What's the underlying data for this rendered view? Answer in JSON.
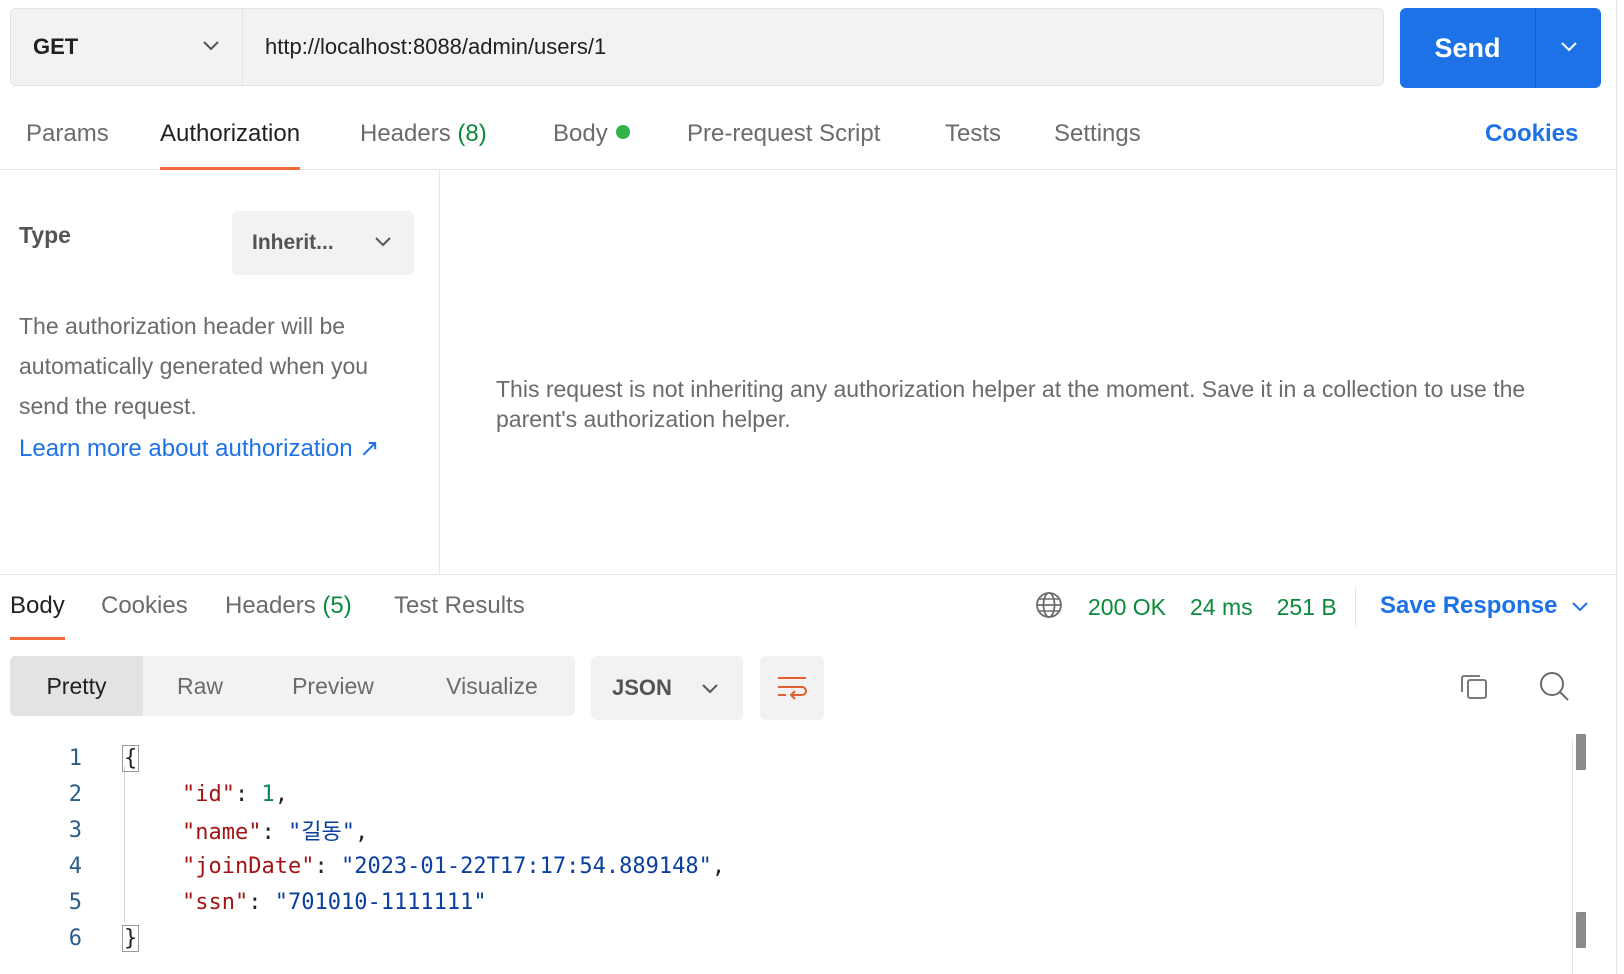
{
  "request": {
    "method": "GET",
    "url": "http://localhost:8088/admin/users/1",
    "send_label": "Send"
  },
  "request_tabs": {
    "params": "Params",
    "authorization": "Authorization",
    "headers": "Headers",
    "headers_count": "(8)",
    "body": "Body",
    "pre_request": "Pre-request Script",
    "tests": "Tests",
    "settings": "Settings",
    "cookies": "Cookies",
    "active": "Authorization"
  },
  "authorization": {
    "type_label": "Type",
    "type_value": "Inherit...",
    "description": "The authorization header will be automatically generated when you send the request.",
    "learn_more": "Learn more about authorization ↗",
    "message": "This request is not inheriting any authorization helper at the moment. Save it in a collection to use the parent's authorization helper."
  },
  "response_tabs": {
    "body": "Body",
    "cookies": "Cookies",
    "headers": "Headers",
    "headers_count": "(5)",
    "test_results": "Test Results",
    "active": "Body"
  },
  "response_status": {
    "status": "200 OK",
    "time": "24 ms",
    "size": "251 B",
    "save_response": "Save Response"
  },
  "view_modes": {
    "pretty": "Pretty",
    "raw": "Raw",
    "preview": "Preview",
    "visualize": "Visualize",
    "active": "Pretty"
  },
  "format": "JSON",
  "colors": {
    "send": "#1d72e8",
    "active_tab_underline": "#f26b3a",
    "status_ok": "#0a8a3a",
    "link": "#1d72e8",
    "body_dot": "#2fb34a"
  },
  "code": {
    "line_numbers": [
      "1",
      "2",
      "3",
      "4",
      "5",
      "6"
    ],
    "open_brace": "{",
    "close_brace": "}",
    "fields": [
      {
        "key": "\"id\"",
        "value": "1",
        "type": "number",
        "trailing": ","
      },
      {
        "key": "\"name\"",
        "value": "\"길동\"",
        "type": "string",
        "trailing": ","
      },
      {
        "key": "\"joinDate\"",
        "value": "\"2023-01-22T17:17:54.889148\"",
        "type": "string",
        "trailing": ","
      },
      {
        "key": "\"ssn\"",
        "value": "\"701010-1111111\"",
        "type": "string",
        "trailing": ""
      }
    ]
  }
}
